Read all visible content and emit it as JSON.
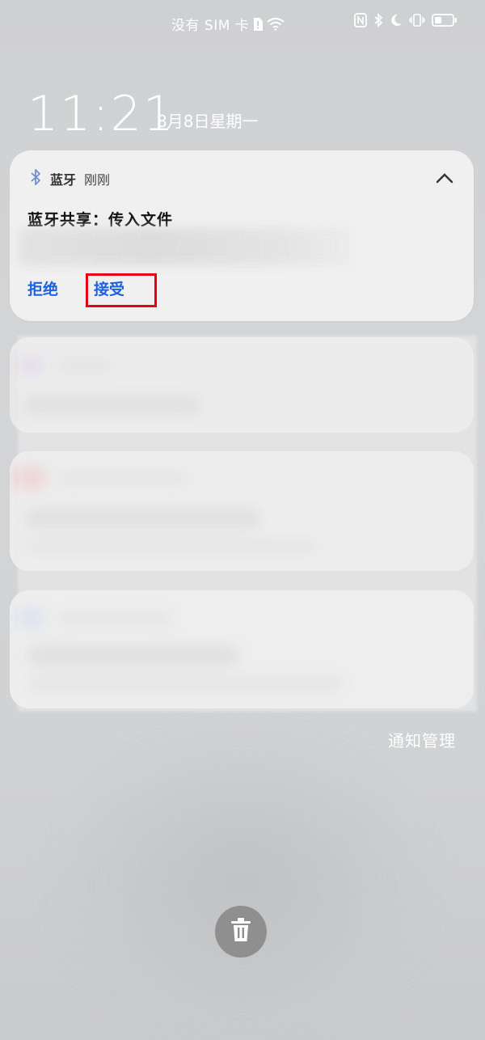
{
  "status_bar": {
    "carrier_text": "没有 SIM 卡",
    "icons": [
      "sim-alert-icon",
      "wifi-icon",
      "nfc-icon",
      "bluetooth-icon",
      "moon-icon",
      "vibrate-icon",
      "battery-icon"
    ]
  },
  "lockscreen": {
    "time": "11:21",
    "date": "8月8日星期一"
  },
  "notification": {
    "app_name": "蓝牙",
    "time": "刚刚",
    "title": "蓝牙共享：传入文件",
    "actions": {
      "reject": "拒绝",
      "accept": "接受"
    },
    "icon": "bluetooth-icon",
    "accent_color": "#1f62e0",
    "highlight_color": "#e60012"
  },
  "footer": {
    "manage_label": "通知管理",
    "clear_icon": "trash-icon"
  }
}
